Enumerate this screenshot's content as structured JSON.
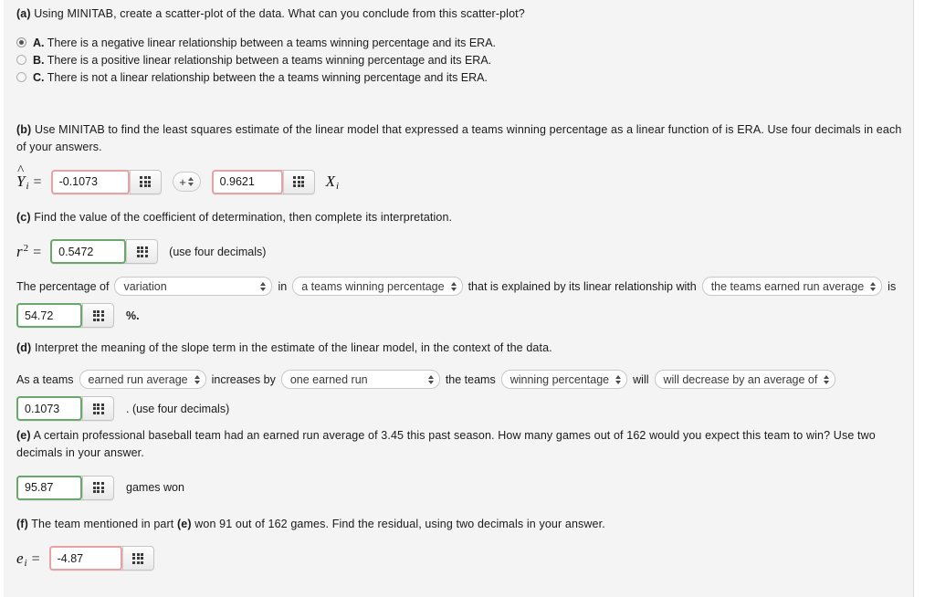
{
  "parts": {
    "a": {
      "label": "(a)",
      "prompt": "Using MINITAB, create a scatter-plot of the data. What can you conclude from this scatter-plot?",
      "choices": [
        {
          "letter": "A.",
          "text": "There is a negative linear relationship between a teams winning percentage and its ERA.",
          "selected": true
        },
        {
          "letter": "B.",
          "text": "There is a positive linear relationship between a teams winning percentage and its ERA.",
          "selected": false
        },
        {
          "letter": "C.",
          "text": "There is not a linear relationship between the a teams winning percentage and its ERA.",
          "selected": false
        }
      ]
    },
    "b": {
      "label": "(b)",
      "prompt": "Use MINITAB to find the least squares estimate of the linear model that expressed a teams winning percentage as a linear function of is ERA. Use four decimals in each of your answers.",
      "yhat_label": "Y",
      "yhat_sub": "i",
      "equals": "=",
      "intercept_value": "-0.1073",
      "operator_sign": "+",
      "slope_value": "0.9621",
      "x_label": "X",
      "x_sub": "i"
    },
    "c": {
      "label": "(c)",
      "prompt": "Find the value of the coefficient of determination, then complete its interpretation.",
      "r2_label": "r",
      "r2_sup": "2",
      "equals": "=",
      "r2_value": "0.5472",
      "r2_hint": "(use four decimals)",
      "sentence_1": "The percentage of",
      "dropdown_1": "variation",
      "sentence_2": "in",
      "dropdown_2": "a teams winning percentage",
      "sentence_3": "that is explained by its linear relationship with",
      "dropdown_3": "the teams earned run average",
      "sentence_4": "is",
      "percent_value": "54.72",
      "percent_suffix": "%."
    },
    "d": {
      "label": "(d)",
      "prompt": "Interpret the meaning of the slope term in the estimate of the linear model, in the context of the data.",
      "sentence_1": "As a teams",
      "dropdown_1": "earned run average",
      "sentence_2": "increases by",
      "dropdown_2": "one earned run",
      "sentence_3": "the teams",
      "dropdown_3": "winning percentage",
      "sentence_4": "will",
      "dropdown_4": "will decrease by an average of",
      "slope_value": "0.1073",
      "hint": ". (use four decimals)"
    },
    "e": {
      "label": "(e)",
      "prompt": "A certain professional baseball team had an earned run average of 3.45 this past season. How many games out of 162 would you expect this team to win? Use two decimals in your answer.",
      "games_value": "95.87",
      "games_suffix": "games won"
    },
    "f": {
      "label": "(f)",
      "prompt_pre": "The team mentioned in part",
      "prompt_ref": "(e)",
      "prompt_post": "won 91 out of 162 games. Find the residual, using two decimals in your answer.",
      "e_label": "e",
      "e_sub": "i",
      "equals": "=",
      "residual_value": "-4.87"
    }
  },
  "icons": {
    "grid": "grid-dots-icon",
    "stepper_arrows": "up-down-arrows-icon",
    "dropdown_arrows": "up-down-arrows-icon"
  },
  "colors": {
    "background": "#f4f4f4",
    "incorrect_border": "#e7a3a3",
    "correct_border": "#68a868",
    "text": "#1a1a1a"
  }
}
